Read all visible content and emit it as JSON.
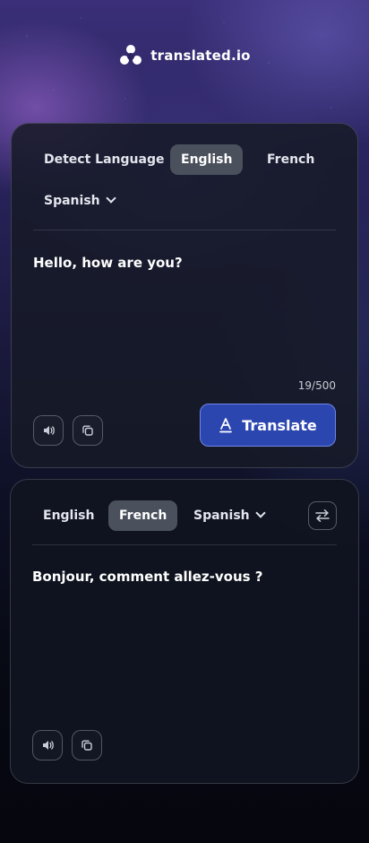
{
  "app": {
    "brand": "translated.io"
  },
  "source": {
    "tabs": [
      {
        "label": "Detect Language",
        "active": false
      },
      {
        "label": "English",
        "active": true
      },
      {
        "label": "French",
        "active": false
      },
      {
        "label": "Spanish",
        "active": false,
        "dropdown": true
      }
    ],
    "text": "Hello, how are you?",
    "counter": "19/500",
    "translate_label": "Translate",
    "icons": [
      "speaker-icon",
      "copy-icon",
      "translate-icon"
    ]
  },
  "target": {
    "tabs": [
      {
        "label": "English",
        "active": false
      },
      {
        "label": "French",
        "active": true
      },
      {
        "label": "Spanish",
        "active": false,
        "dropdown": true
      }
    ],
    "text": "Bonjour, comment allez-vous ?",
    "icons": [
      "swap-icon",
      "speaker-icon",
      "copy-icon"
    ]
  },
  "colors": {
    "accent": "#2c46b0",
    "tab_active": "#4a505c",
    "card": "#161a26"
  }
}
